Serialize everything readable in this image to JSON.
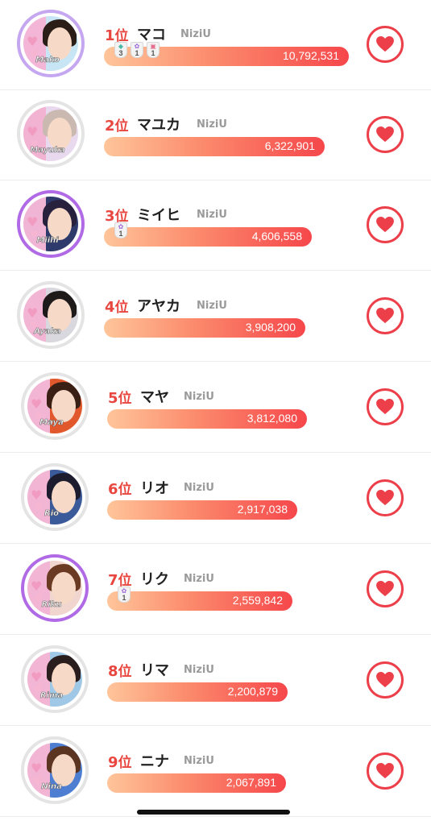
{
  "group_label": "NiziU",
  "rank_suffix": "位",
  "rankings": [
    {
      "rank": "1",
      "name": "マコ",
      "votes": "10,792,531",
      "avatar_label": "Mako",
      "ring": "rainbow",
      "badges": [
        {
          "kind": "teal",
          "num": "3"
        },
        {
          "kind": "purple",
          "num": "1"
        },
        {
          "kind": "pink",
          "num": "1"
        }
      ],
      "colors": {
        "bgL": "#f3b6d6",
        "bgR": "#c7e5f4",
        "hair": "#2b1d18"
      }
    },
    {
      "rank": "2",
      "name": "マユカ",
      "votes": "6,322,901",
      "avatar_label": "Mayuka",
      "ring": "gray",
      "badges": [],
      "colors": {
        "bgL": "#f2b3d3",
        "bgR": "#e9d9ef",
        "hair": "#c9b9b0"
      }
    },
    {
      "rank": "3",
      "name": "ミイヒ",
      "votes": "4,606,558",
      "avatar_label": "Miihi",
      "ring": "purple",
      "badges": [
        {
          "kind": "purple",
          "num": "1"
        }
      ],
      "colors": {
        "bgL": "#f0b4d4",
        "bgR": "#2e3a6c",
        "hair": "#27213e"
      }
    },
    {
      "rank": "4",
      "name": "アヤカ",
      "votes": "3,908,200",
      "avatar_label": "Ayaka",
      "ring": "gray",
      "badges": [],
      "colors": {
        "bgL": "#f2b6d4",
        "bgR": "#d8d8de",
        "hair": "#1f1a1a"
      }
    },
    {
      "rank": "5",
      "name": "マヤ",
      "votes": "3,812,080",
      "avatar_label": "Maya",
      "ring": "gray",
      "badges": [],
      "colors": {
        "bgL": "#f2b6d4",
        "bgR": "#e0582c",
        "hair": "#3a1f14"
      }
    },
    {
      "rank": "6",
      "name": "リオ",
      "votes": "2,917,038",
      "avatar_label": "Rio",
      "ring": "gray",
      "badges": [],
      "colors": {
        "bgL": "#f2b6d4",
        "bgR": "#3b5a9a",
        "hair": "#1c1c2e"
      }
    },
    {
      "rank": "7",
      "name": "リク",
      "votes": "2,559,842",
      "avatar_label": "Riku",
      "ring": "purple",
      "badges": [
        {
          "kind": "purple",
          "num": "1"
        }
      ],
      "colors": {
        "bgL": "#f2b6d4",
        "bgR": "#f0d6cf",
        "hair": "#6a3a22"
      }
    },
    {
      "rank": "8",
      "name": "リマ",
      "votes": "2,200,879",
      "avatar_label": "Rima",
      "ring": "gray",
      "badges": [],
      "colors": {
        "bgL": "#f2b6d4",
        "bgR": "#9fc8e6",
        "hair": "#2a1d1d"
      }
    },
    {
      "rank": "9",
      "name": "ニナ",
      "votes": "2,067,891",
      "avatar_label": "Nina",
      "ring": "gray",
      "badges": [],
      "colors": {
        "bgL": "#f2b6d4",
        "bgR": "#4d7ed1",
        "hair": "#5b3522"
      }
    }
  ],
  "colors": {
    "accent": "#e8463f",
    "bar_start": "#ffc59a",
    "bar_end": "#f6474b",
    "vote_button": "#ec3f4a"
  }
}
